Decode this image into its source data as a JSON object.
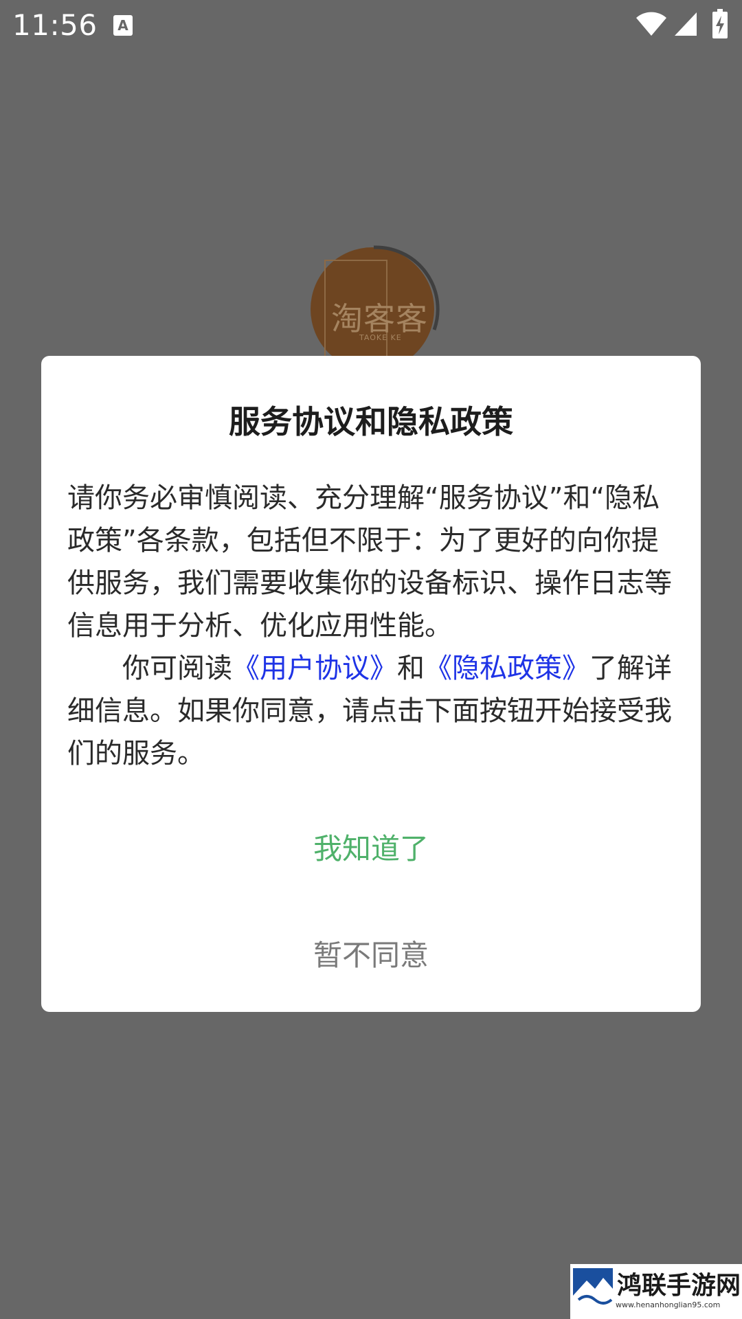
{
  "status_bar": {
    "time": "11:56",
    "notification_glyph": "A",
    "icons": [
      "notification-icon",
      "wifi-icon",
      "cell-signal-icon",
      "battery-charging-icon"
    ]
  },
  "splash": {
    "logo_text": "淘客客",
    "logo_subtext": "TAOKE KE",
    "logo_color": "#6e4521"
  },
  "dialog": {
    "title": "服务协议和隐私政策",
    "paragraph1": "请你务必审慎阅读、充分理解“服务协议”和“隐私政策”各条款，包括但不限于：为了更好的向你提供服务，我们需要收集你的设备标识、操作日志等信息用于分析、优化应用性能。",
    "paragraph2": {
      "prefix": "你可阅读",
      "user_agreement_link": "《用户协议》",
      "conjunction": "和",
      "privacy_policy_link": "《隐私政策》",
      "suffix": "了解详细信息。如果你同意，请点击下面按钮开始接受我们的服务。"
    },
    "ack_button_label": "我知道了",
    "decline_button_label": "暂不同意",
    "colors": {
      "link": "#1e33e6",
      "ack": "#4fb16a",
      "decline": "#7a7a7a",
      "overlay": "#676767"
    }
  },
  "watermark": {
    "title": "鸿联手游网",
    "url": "www.henanhonglian95.com"
  }
}
